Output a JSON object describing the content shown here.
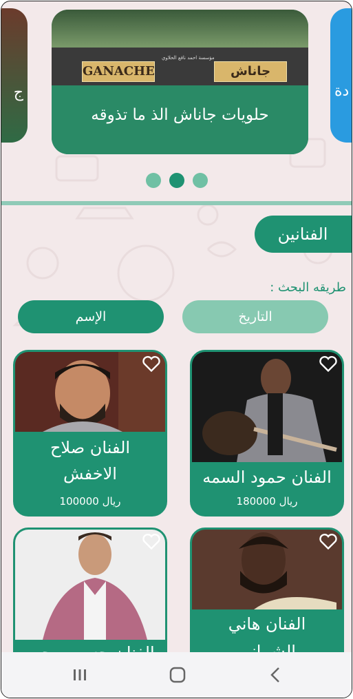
{
  "carousel": {
    "left_text": "ج",
    "right_text": "دة",
    "banner_title": "حلويات جاناش الذ ما تذوقه",
    "sign_en": "GANACHE",
    "sign_ar": "جاناش",
    "sign_small": "مؤسسة احمد نافع الحلاوي",
    "active_index": 1
  },
  "section": {
    "title": "الفنانين",
    "search_label": "طريقه البحث :",
    "sort_name_label": "الإسم",
    "sort_date_label": "التاريخ"
  },
  "artists": [
    {
      "name_line1": "الفنان صلاح",
      "name_line2": "الاخفش",
      "price": "100000 ريال"
    },
    {
      "name_line1": "الفنان حمود السمه",
      "name_line2": "",
      "price": "180000 ريال"
    },
    {
      "name_line1": "الفنان حسين محب",
      "name_line2": "",
      "price": ""
    },
    {
      "name_line1": "الفنان هاني",
      "name_line2": "الشيباني",
      "price": ""
    }
  ],
  "icons": {
    "heart": "heart-outline-icon",
    "nav_recent": "recent-apps-icon",
    "nav_home": "home-icon",
    "nav_back": "back-icon"
  },
  "colors": {
    "accent": "#1f9272",
    "accent_light": "#87c9b1",
    "background": "#f3e9ea"
  }
}
